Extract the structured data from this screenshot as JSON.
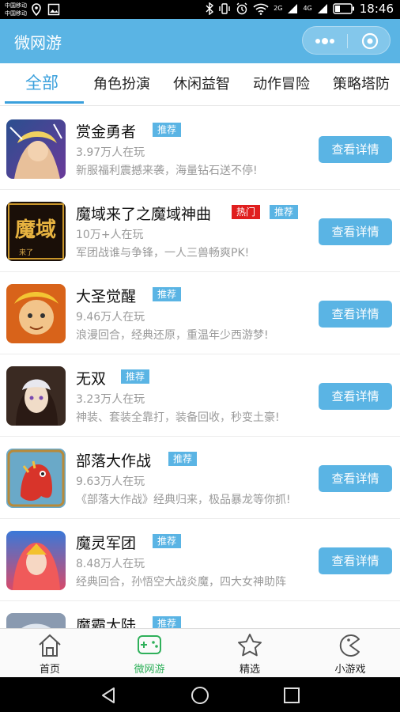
{
  "statusbar": {
    "carrier1": "中国移动",
    "carrier2": "中国移动",
    "time": "18:46",
    "net1": "2G",
    "net2": "4G"
  },
  "app": {
    "title": "微网游",
    "accent": "#5ab4e4"
  },
  "tabs": [
    {
      "label": "全部",
      "active": true
    },
    {
      "label": "角色扮演"
    },
    {
      "label": "休闲益智"
    },
    {
      "label": "动作冒险"
    },
    {
      "label": "策略塔防"
    }
  ],
  "games": [
    {
      "name": "赏金勇者",
      "badges": [
        "推荐"
      ],
      "players": "3.97万人在玩",
      "desc": "新服福利震撼来袭，海量钻石送不停!",
      "button": "查看详情"
    },
    {
      "name": "魔域来了之魔域神曲",
      "badges": [
        "热门",
        "推荐"
      ],
      "players": "10万+人在玩",
      "desc": "军团战谁与争锋，一人三兽畅爽PK!",
      "button": "查看详情",
      "thumb_text": "魔域",
      "thumb_sub": "来了"
    },
    {
      "name": "大圣觉醒",
      "badges": [
        "推荐"
      ],
      "players": "9.46万人在玩",
      "desc": "浪漫回合，经典还原，重温年少西游梦!",
      "button": "查看详情"
    },
    {
      "name": "无双",
      "badges": [
        "推荐"
      ],
      "players": "3.23万人在玩",
      "desc": "神装、套装全靠打，装备回收，秒变土豪!",
      "button": "查看详情"
    },
    {
      "name": "部落大作战",
      "badges": [
        "推荐"
      ],
      "players": "9.63万人在玩",
      "desc": "《部落大作战》经典归来，极品暴龙等你抓!",
      "button": "查看详情"
    },
    {
      "name": "魔灵军团",
      "badges": [
        "推荐"
      ],
      "players": "8.48万人在玩",
      "desc": "经典回合，孙悟空大战炎魔，四大女神助阵",
      "button": "查看详情"
    },
    {
      "name": "魔霸大陆",
      "badges": [
        "推荐"
      ],
      "players": "",
      "desc": "",
      "button": ""
    }
  ],
  "bottom_nav": [
    {
      "label": "首页",
      "icon": "home-icon"
    },
    {
      "label": "微网游",
      "icon": "gamepad-icon",
      "active": true,
      "color": "#2fb05a"
    },
    {
      "label": "精选",
      "icon": "star-icon"
    },
    {
      "label": "小游戏",
      "icon": "pacman-icon"
    }
  ]
}
